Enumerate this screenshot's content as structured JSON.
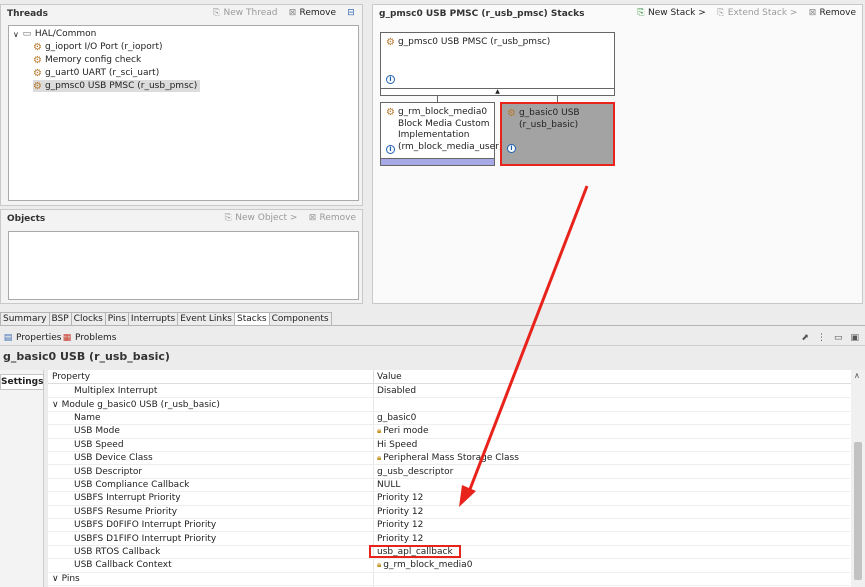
{
  "threads": {
    "title": "Threads",
    "new_thread": "New Thread",
    "remove": "Remove",
    "tree": [
      {
        "label": "HAL/Common",
        "level": 0
      },
      {
        "label": "g_ioport I/O Port (r_ioport)",
        "level": 1
      },
      {
        "label": "Memory config check",
        "level": 1
      },
      {
        "label": "g_uart0 UART (r_sci_uart)",
        "level": 1
      },
      {
        "label": "g_pmsc0 USB PMSC (r_usb_pmsc)",
        "level": 1,
        "selected": true
      }
    ]
  },
  "objects": {
    "title": "Objects",
    "new_object": "New Object >",
    "remove": "Remove"
  },
  "stacks": {
    "title": "g_pmsc0 USB PMSC (r_usb_pmsc) Stacks",
    "new_stack": "New Stack >",
    "extend_stack": "Extend Stack >",
    "remove": "Remove",
    "top_component": "g_pmsc0 USB PMSC (r_usb_pmsc)",
    "child_left": "g_rm_block_media0 Block Media Custom Implementation (rm_block_media_user)",
    "child_right": "g_basic0 USB (r_usb_basic)"
  },
  "tabs": [
    "Summary",
    "BSP",
    "Clocks",
    "Pins",
    "Interrupts",
    "Event Links",
    "Stacks",
    "Components"
  ],
  "active_tab": "Stacks",
  "properties": {
    "tab_properties": "Properties",
    "tab_problems": "Problems",
    "heading": "g_basic0 USB (r_usb_basic)",
    "settings_tab": "Settings",
    "col_property": "Property",
    "col_value": "Value",
    "rows": [
      {
        "name": "Multiplex Interrupt",
        "value": "Disabled",
        "indent": 2
      },
      {
        "name": "Module g_basic0 USB (r_usb_basic)",
        "value": "",
        "indent": 1,
        "expander": true
      },
      {
        "name": "Name",
        "value": "g_basic0",
        "indent": 2
      },
      {
        "name": "USB Mode",
        "value": "Peri mode",
        "indent": 2,
        "locked": true
      },
      {
        "name": "USB Speed",
        "value": "Hi Speed",
        "indent": 2
      },
      {
        "name": "USB Device Class",
        "value": "Peripheral Mass Storage Class",
        "indent": 2,
        "locked": true
      },
      {
        "name": "USB Descriptor",
        "value": "g_usb_descriptor",
        "indent": 2
      },
      {
        "name": "USB Compliance Callback",
        "value": "NULL",
        "indent": 2
      },
      {
        "name": "USBFS Interrupt Priority",
        "value": "Priority 12",
        "indent": 2
      },
      {
        "name": "USBFS Resume Priority",
        "value": "Priority 12",
        "indent": 2
      },
      {
        "name": "USBFS D0FIFO Interrupt Priority",
        "value": "Priority 12",
        "indent": 2
      },
      {
        "name": "USBFS D1FIFO Interrupt Priority",
        "value": "Priority 12",
        "indent": 2
      },
      {
        "name": "USB RTOS Callback",
        "value": "usb_apl_callback",
        "indent": 2,
        "highlight": true
      },
      {
        "name": "USB Callback Context",
        "value": "g_rm_block_media0",
        "indent": 2,
        "locked": true
      },
      {
        "name": "Pins",
        "value": "",
        "indent": 1,
        "expander": true
      }
    ]
  },
  "colors": {
    "highlight": "#e8231b",
    "selected_component": "#a3a3a3",
    "component_strip": "#a7a9e6",
    "gear": "#b8782a"
  }
}
